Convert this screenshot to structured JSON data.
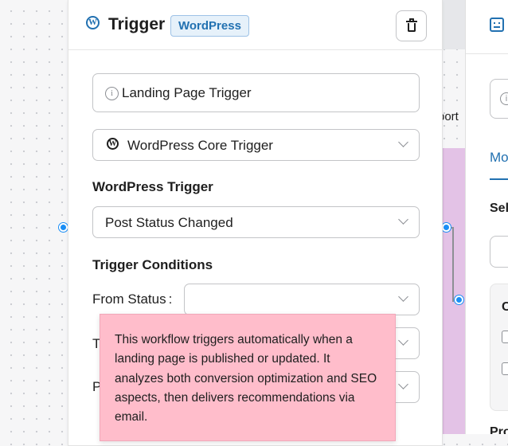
{
  "panel": {
    "title": "Trigger",
    "badge": "WordPress",
    "name_value": "Landing Page Trigger",
    "trigger_source": "WordPress Core Trigger",
    "wp_trigger_label": "WordPress Trigger",
    "wp_trigger_value": "Post Status Changed",
    "conditions_label": "Trigger Conditions",
    "from_status_label": "From Status",
    "from_status_colon": ":",
    "from_status_value": "",
    "row2_label_initial": "T",
    "row3_label_initial": "P"
  },
  "tooltip": {
    "text": "This workflow triggers automatically when a landing page is published or updated. It analyzes both conversion optimization and SEO aspects, then delivers recommendations via email."
  },
  "background": {
    "node_text": "port"
  },
  "right_panel": {
    "tab_label": "Mo",
    "section_label": "Sel",
    "box_title": "C",
    "bottom_label": "Pro"
  },
  "colors": {
    "accent": "#2271b1",
    "tooltip_bg": "#ffbdcb",
    "node_bg": "#e3c2e6",
    "connector": "#1a8ef5"
  },
  "icons": {
    "header": "wordpress-icon",
    "delete": "trash-icon",
    "info": "info-icon",
    "chevron": "chevron-down-icon"
  }
}
